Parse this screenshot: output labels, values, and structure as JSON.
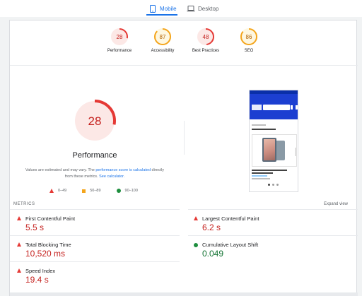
{
  "tabs": [
    {
      "label": "Mobile",
      "icon": "smartphone-icon",
      "active": true
    },
    {
      "label": "Desktop",
      "icon": "laptop-icon",
      "active": false
    }
  ],
  "categories": [
    {
      "score": "28",
      "label": "Performance",
      "status": "fail",
      "color": "#e53935",
      "fraction": 0.28
    },
    {
      "score": "87",
      "label": "Accessibility",
      "status": "average",
      "color": "#f4a51c",
      "fraction": 0.87
    },
    {
      "score": "48",
      "label": "Best Practices",
      "status": "fail",
      "color": "#e53935",
      "fraction": 0.48
    },
    {
      "score": "86",
      "label": "SEO",
      "status": "average",
      "color": "#f4a51c",
      "fraction": 0.86
    }
  ],
  "main_gauge": {
    "score": "28",
    "fraction": 0.28,
    "title": "Performance",
    "color": "#e53935"
  },
  "note": {
    "pre": "Values are estimated and may vary. The ",
    "link1": "performance score is calculated",
    "mid": " directly from these metrics. ",
    "link2": "See calculator."
  },
  "legend": [
    {
      "label": "0–49",
      "shape": "red-triangle"
    },
    {
      "label": "50–89",
      "shape": "orange-square"
    },
    {
      "label": "90–100",
      "shape": "green-circle"
    }
  ],
  "metrics": {
    "header": "METRICS",
    "expand_label": "Expand view",
    "items": [
      {
        "name": "First Contentful Paint",
        "value": "5.5 s",
        "status": "fail"
      },
      {
        "name": "Largest Contentful Paint",
        "value": "6.2 s",
        "status": "fail"
      },
      {
        "name": "Total Blocking Time",
        "value": "10,520 ms",
        "status": "fail"
      },
      {
        "name": "Cumulative Layout Shift",
        "value": "0.049",
        "status": "pass"
      },
      {
        "name": "Speed Index",
        "value": "19.4 s",
        "status": "fail"
      }
    ]
  },
  "colors": {
    "accent": "#1a73e8",
    "fail": "#e53935",
    "average": "#f4a51c",
    "pass": "#1e8e3e"
  }
}
